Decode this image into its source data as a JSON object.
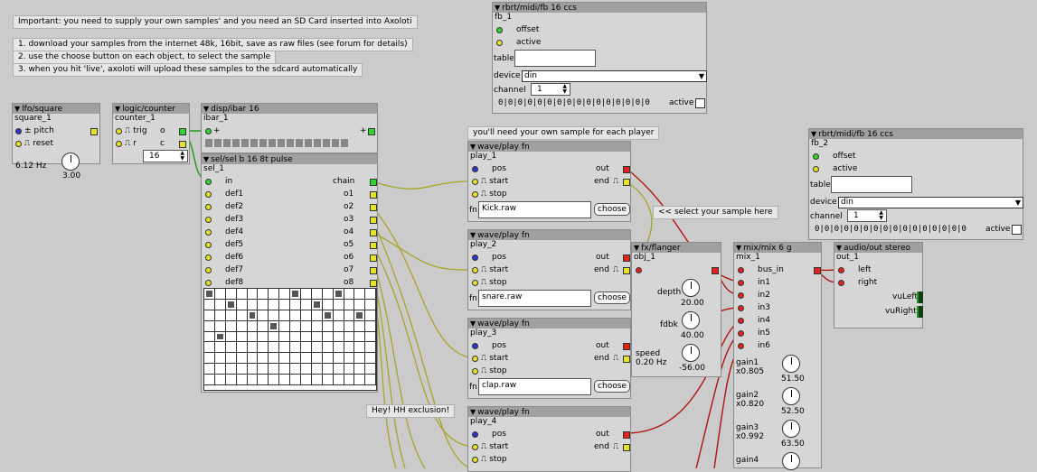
{
  "notes": {
    "important": "Important: you need to supply your own samples' and you need an SD Card inserted into Axoloti",
    "step1": "1. download your samples from the internet 48k, 16bit, save as raw files (see forum for details)",
    "step2": "2. use the choose button on each object, to select the sample",
    "step3": "3. when you hit 'live', axoloti will upload these samples to the sdcard automatically",
    "own_sample": "you'll need your own sample for each player",
    "select_sample": "<< select your sample here",
    "hh_exclusion": "Hey! HH exclusion!"
  },
  "lfo": {
    "type": "lfo/square",
    "name": "square_1",
    "pitch": "pitch",
    "pitch_sym": "±",
    "reset": "reset",
    "freq": "6.12 Hz",
    "knob_value": "3.00"
  },
  "counter": {
    "type": "logic/counter",
    "name": "counter_1",
    "trig": "trig",
    "r": "r",
    "o": "o",
    "c": "c",
    "value": "16"
  },
  "ibar": {
    "type": "disp/ibar 16",
    "name": "ibar_1",
    "plus": "+"
  },
  "seq": {
    "type": "sel/sel b 16 8t pulse",
    "name": "sel_1",
    "in": "in",
    "chain": "chain",
    "defs": [
      "def1",
      "def2",
      "def3",
      "def4",
      "def5",
      "def6",
      "def7",
      "def8"
    ],
    "outs": [
      "o1",
      "o2",
      "o3",
      "o4",
      "o5",
      "o6",
      "o7",
      "o8"
    ],
    "pattern": [
      [
        1,
        0,
        0,
        0,
        0,
        0,
        0,
        0,
        1,
        0,
        0,
        0,
        1,
        0,
        0,
        0
      ],
      [
        0,
        0,
        1,
        0,
        0,
        0,
        0,
        0,
        0,
        0,
        1,
        0,
        0,
        0,
        0,
        0
      ],
      [
        0,
        0,
        0,
        0,
        1,
        0,
        0,
        0,
        0,
        0,
        0,
        1,
        0,
        0,
        1,
        0
      ],
      [
        0,
        0,
        0,
        0,
        0,
        0,
        1,
        0,
        0,
        0,
        0,
        0,
        0,
        0,
        0,
        0
      ],
      [
        0,
        1,
        0,
        0,
        0,
        0,
        0,
        0,
        0,
        0,
        0,
        0,
        0,
        0,
        0,
        0
      ],
      [
        0,
        0,
        0,
        0,
        0,
        0,
        0,
        0,
        0,
        0,
        0,
        0,
        0,
        0,
        0,
        0
      ],
      [
        0,
        0,
        0,
        0,
        0,
        0,
        0,
        0,
        0,
        0,
        0,
        0,
        0,
        0,
        0,
        0
      ],
      [
        0,
        0,
        0,
        0,
        0,
        0,
        0,
        0,
        0,
        0,
        0,
        0,
        0,
        0,
        0,
        0
      ],
      [
        0,
        0,
        0,
        0,
        0,
        0,
        0,
        0,
        0,
        0,
        0,
        0,
        0,
        0,
        0,
        0
      ]
    ]
  },
  "players": [
    {
      "type": "wave/play fn",
      "name": "play_1",
      "pos": "pos",
      "start": "start",
      "stop": "stop",
      "out": "out",
      "end": "end",
      "fn": "fn",
      "file": "Kick.raw",
      "choose": "choose"
    },
    {
      "type": "wave/play fn",
      "name": "play_2",
      "pos": "pos",
      "start": "start",
      "stop": "stop",
      "out": "out",
      "end": "end",
      "fn": "fn",
      "file": "snare.raw",
      "choose": "choose"
    },
    {
      "type": "wave/play fn",
      "name": "play_3",
      "pos": "pos",
      "start": "start",
      "stop": "stop",
      "out": "out",
      "end": "end",
      "fn": "fn",
      "file": "clap.raw",
      "choose": "choose"
    },
    {
      "type": "wave/play fn",
      "name": "play_4",
      "pos": "pos",
      "start": "start",
      "stop": "stop",
      "out": "out",
      "end": "end"
    }
  ],
  "fb1": {
    "type": "rbrt/midi/fb 16 ccs",
    "name": "fb_1",
    "offset": "offset",
    "active": "active",
    "table": "table",
    "device_label": "device",
    "device": "din",
    "channel_label": "channel",
    "channel": "1",
    "bits": "0|0|0|0|0|0|0|0|0|0|0|0|0|0|0|0",
    "active_label": "active"
  },
  "fb2": {
    "type": "rbrt/midi/fb 16 ccs",
    "name": "fb_2",
    "offset": "offset",
    "active": "active",
    "table": "table",
    "device_label": "device",
    "device": "din",
    "channel_label": "channel",
    "channel": "1",
    "bits": "0|0|0|0|0|0|0|0|0|0|0|0|0|0|0|0",
    "active_label": "active"
  },
  "flanger": {
    "type": "fx/flanger",
    "name": "obj_1",
    "depth": "depth",
    "depth_val": "20.00",
    "fdbk": "fdbk",
    "fdbk_val": "40.00",
    "speed": "speed",
    "speed_val": "0.20 Hz",
    "knob3_val": "-56.00"
  },
  "mixer": {
    "type": "mix/mix 6 g",
    "name": "mix_1",
    "bus_in": "bus_in",
    "ins": [
      "in1",
      "in2",
      "in3",
      "in4",
      "in5",
      "in6"
    ],
    "gains": [
      {
        "label": "gain1",
        "x": "x0.805",
        "val": "51.50"
      },
      {
        "label": "gain2",
        "x": "x0.820",
        "val": "52.50"
      },
      {
        "label": "gain3",
        "x": "x0.992",
        "val": "63.50"
      },
      {
        "label": "gain4",
        "x": "",
        "val": ""
      }
    ]
  },
  "audio_out": {
    "type": "audio/out stereo",
    "name": "out_1",
    "left": "left",
    "right": "right",
    "vuleft": "vuLeft",
    "vuright": "vuRight"
  },
  "colors": {
    "background": "#cbcbcb",
    "header": "#a0a0a0",
    "wire_red": "#b0140f",
    "wire_yellow": "#a8a52a",
    "wire_green": "#22a022"
  }
}
